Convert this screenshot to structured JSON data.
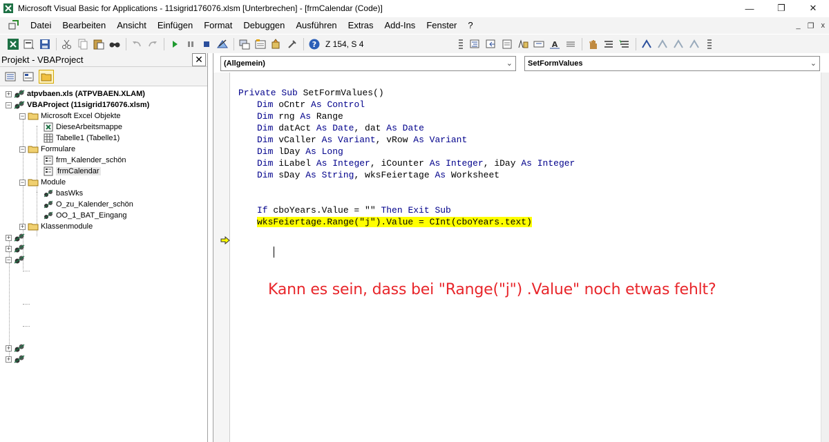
{
  "window": {
    "title": "Microsoft Visual Basic for Applications - 11sigrid176076.xlsm [Unterbrechen] - [frmCalendar (Code)]",
    "minimize": "—",
    "restore": "❐",
    "close": "✕"
  },
  "menu": {
    "items": [
      "Datei",
      "Bearbeiten",
      "Ansicht",
      "Einfügen",
      "Format",
      "Debuggen",
      "Ausführen",
      "Extras",
      "Add-Ins",
      "Fenster",
      "?"
    ],
    "mdi_minimize": "_",
    "mdi_restore": "❐",
    "mdi_close": "x"
  },
  "toolbar": {
    "position": "Z 154, S 4"
  },
  "project": {
    "title": "Projekt - VBAProject",
    "close": "✕",
    "tree": [
      {
        "label": "atpvbaen.xls (ATPVBAEN.XLAM)",
        "bold": true
      },
      {
        "label": "VBAProject (11sigrid176076.xlsm)",
        "bold": true
      },
      {
        "label": "Microsoft Excel Objekte"
      },
      {
        "label": "DieseArbeitsmappe"
      },
      {
        "label": "Tabelle1 (Tabelle1)"
      },
      {
        "label": "Formulare"
      },
      {
        "label": "frm_Kalender_schön"
      },
      {
        "label": "frmCalendar",
        "selected": true
      },
      {
        "label": "Module"
      },
      {
        "label": "basWks"
      },
      {
        "label": "O_zu_Kalender_schön"
      },
      {
        "label": "OO_1_BAT_Eingang"
      },
      {
        "label": "Klassenmodule"
      }
    ]
  },
  "code": {
    "object_combo": "(Allgemein)",
    "proc_combo": "SetFormValues",
    "lines": {
      "l1": {
        "kw": "Private Sub",
        "rest": " SetFormValues()"
      },
      "l2": {
        "kw": "Dim",
        "a": " oCntr ",
        "kw2": "As",
        "b": " ",
        "kw3": "Control"
      },
      "l3": {
        "kw": "Dim",
        "a": " rng ",
        "kw2": "As",
        "b": " Range"
      },
      "l4": {
        "kw": "Dim",
        "a": " datAct ",
        "kw2": "As",
        "kw3": " Date",
        "b": ", dat ",
        "kw4": "As",
        "kw5": " Date"
      },
      "l5": {
        "kw": "Dim",
        "a": " vCaller ",
        "kw2": "As",
        "kw3": " Variant",
        "b": ", vRow ",
        "kw4": "As",
        "kw5": " Variant"
      },
      "l6": {
        "kw": "Dim",
        "a": " lDay ",
        "kw2": "As",
        "kw3": " Long"
      },
      "l7": {
        "kw": "Dim",
        "a": " iLabel ",
        "kw2": "As",
        "kw3": " Integer",
        "b": ", iCounter ",
        "kw4": "As",
        "kw5": " Integer",
        "c": ", iDay ",
        "kw6": "As",
        "kw7": " Integer"
      },
      "l8": {
        "kw": "Dim",
        "a": " sDay ",
        "kw2": "As",
        "kw3": " String",
        "b": ", wksFeiertage ",
        "kw4": "As",
        "b2": " Worksheet"
      },
      "l9": {
        "kw": "If",
        "a": " cboYears.Value = \"\" ",
        "kw2": "Then Exit Sub"
      },
      "l10": "wksFeiertage.Range(\"j\").Value = CInt(cboYears.text)"
    },
    "annotation": "Kann es sein, dass bei \"Range(\"j\") .Value\" noch etwas fehlt?"
  },
  "colors": {
    "keyword": "#00008b",
    "highlight": "#ffff00",
    "annotation": "#e8262b"
  }
}
